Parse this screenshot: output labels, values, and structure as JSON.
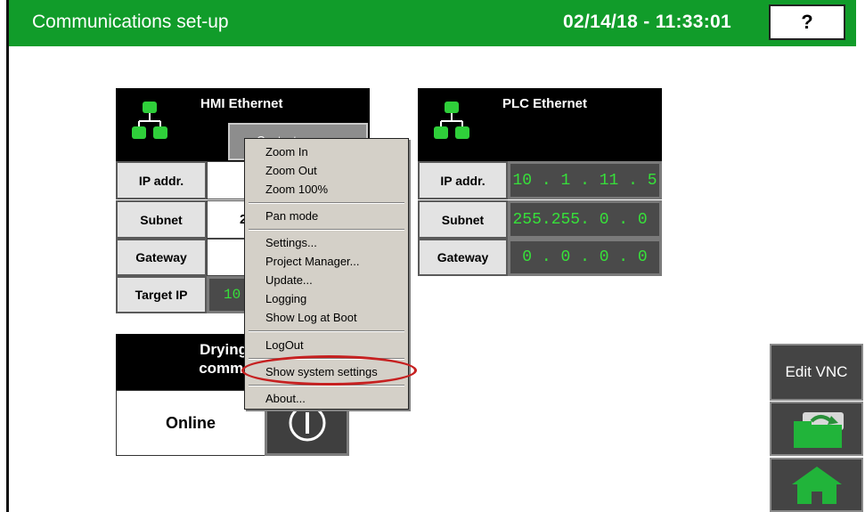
{
  "header": {
    "title": "Communications set-up",
    "datetime": "02/14/18 - 11:33:01",
    "help_label": "?"
  },
  "hmi": {
    "title": "HMI Ethernet",
    "contact_partial": "Contact",
    "rows": [
      {
        "label": "IP addr.",
        "value": ""
      },
      {
        "label": "Subnet",
        "value": "2"
      },
      {
        "label": "Gateway",
        "value": ""
      },
      {
        "label": "Target IP",
        "value": "10"
      }
    ]
  },
  "plc": {
    "title": "PLC Ethernet",
    "rows": [
      {
        "label": "IP addr.",
        "value": " 10 . 1 . 11 . 5 "
      },
      {
        "label": "Subnet",
        "value": "255.255. 0 . 0 "
      },
      {
        "label": "Gateway",
        "value": " 0 . 0 . 0 . 0 "
      }
    ]
  },
  "status": {
    "line1": "Drying m",
    "line2": "communi",
    "state": "Online"
  },
  "context_menu": {
    "items": [
      "Zoom In",
      "Zoom Out",
      "Zoom 100%",
      "Pan mode",
      "Settings...",
      "Project Manager...",
      "Update...",
      "Logging",
      "Show Log at Boot",
      "LogOut",
      "Show system settings",
      "About..."
    ],
    "highlighted": "Show system settings"
  },
  "side": {
    "edit_vnc": "Edit VNC",
    "refresh_icon": "refresh-icon",
    "home_icon": "home-icon"
  },
  "colors": {
    "brand_green": "#119c2a",
    "value_green": "#37e03a",
    "highlight": "#c62020"
  }
}
